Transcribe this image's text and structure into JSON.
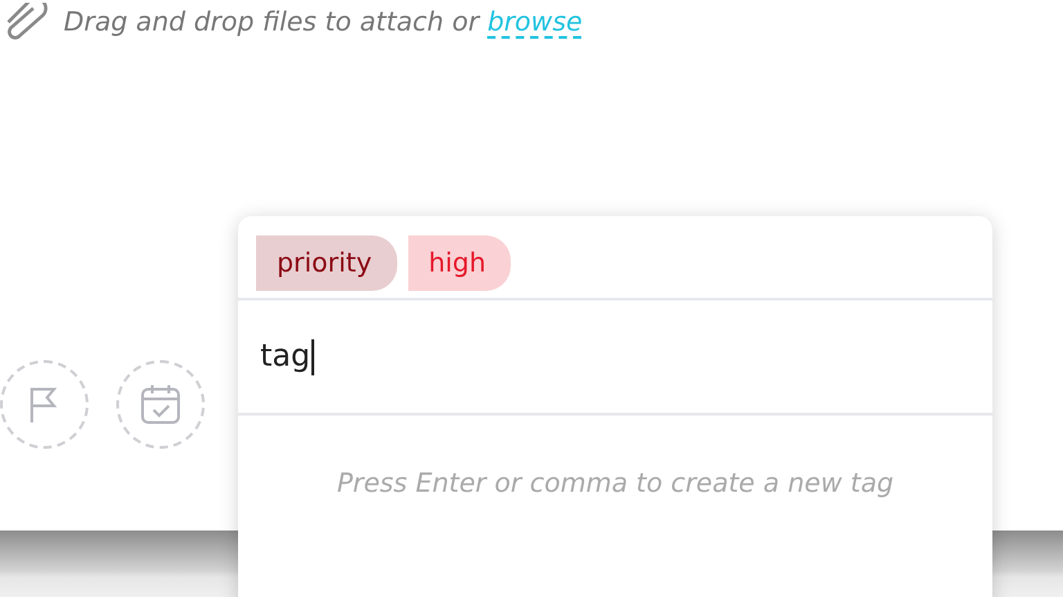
{
  "attachment": {
    "text": "Drag and drop files to attach or",
    "link": "browse"
  },
  "actions": [
    {
      "kind": "flag"
    },
    {
      "kind": "calendar"
    }
  ],
  "tag_popup": {
    "tags": [
      {
        "label": "priority",
        "color": "#8b0a14"
      },
      {
        "label": "high",
        "color": "#e5192a"
      }
    ],
    "input": {
      "value": "tag"
    },
    "hint": "Press Enter or comma to create a new tag"
  }
}
